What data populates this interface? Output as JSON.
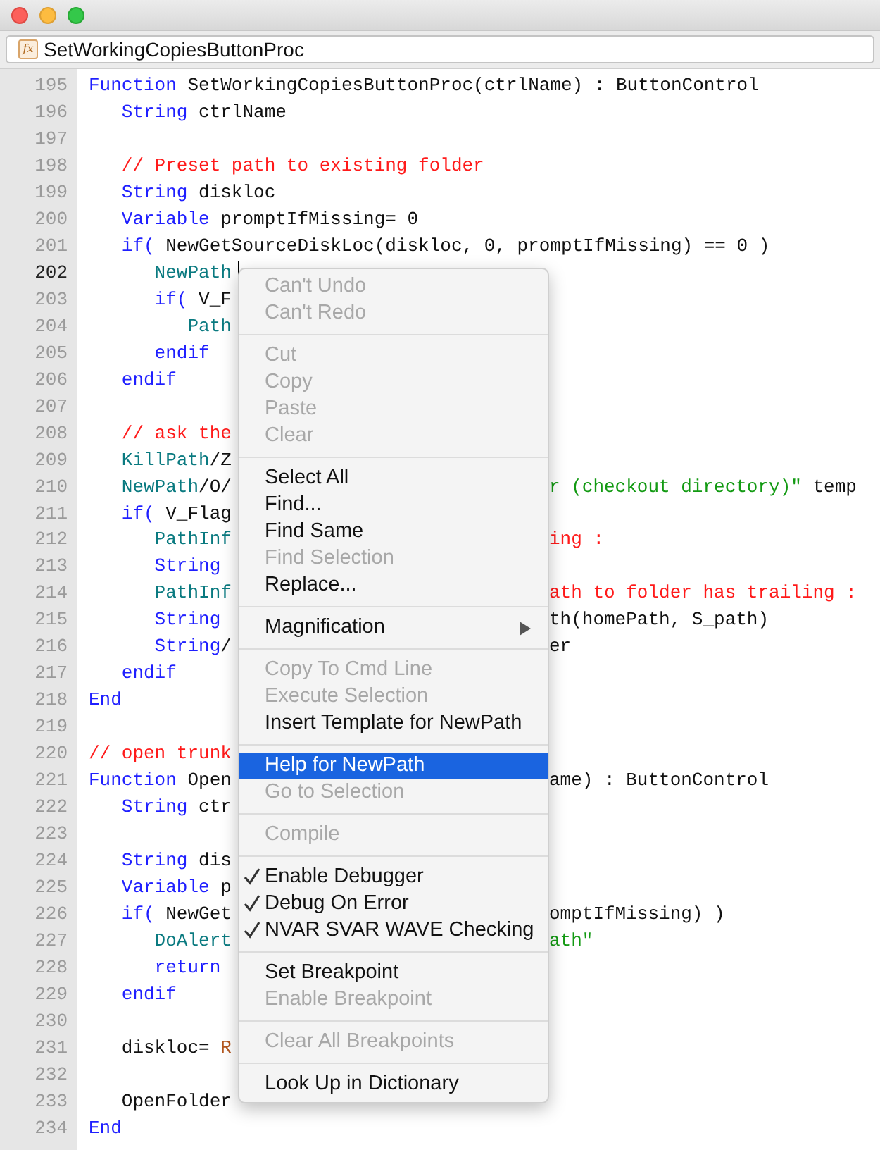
{
  "window": {
    "icon_text": "fx",
    "title": "SetWorkingCopiesButtonProc"
  },
  "code": [
    {
      "num": "195",
      "current": false,
      "left": [
        {
          "kind": "keyword",
          "text": "Function"
        },
        {
          "kind": "plain",
          "text": " SetWorkingCopiesButtonProc(ctrlName) : ButtonControl"
        }
      ]
    },
    {
      "num": "196",
      "current": false,
      "left": [
        {
          "kind": "keyword",
          "text": "   String"
        },
        {
          "kind": "plain",
          "text": " ctrlName"
        }
      ]
    },
    {
      "num": "197",
      "current": false
    },
    {
      "num": "198",
      "current": false,
      "left": [
        {
          "kind": "comment",
          "text": "   // Preset path to existing folder"
        }
      ]
    },
    {
      "num": "199",
      "current": false,
      "left": [
        {
          "kind": "keyword",
          "text": "   String"
        },
        {
          "kind": "plain",
          "text": " diskloc"
        }
      ]
    },
    {
      "num": "200",
      "current": false,
      "left": [
        {
          "kind": "keyword",
          "text": "   Variable"
        },
        {
          "kind": "plain",
          "text": " promptIfMissing= 0"
        }
      ]
    },
    {
      "num": "201",
      "current": false,
      "left": [
        {
          "kind": "keyword",
          "text": "   if("
        },
        {
          "kind": "plain",
          "text": " NewGetSourceDiskLoc(diskloc, 0, promptIfMissing) == 0 )"
        }
      ]
    },
    {
      "num": "202",
      "current": true,
      "left": [
        {
          "kind": "func",
          "text": "      NewPath"
        }
      ]
    },
    {
      "num": "203",
      "current": false,
      "left": [
        {
          "kind": "keyword",
          "text": "      if("
        },
        {
          "kind": "plain",
          "text": " V_F"
        }
      ]
    },
    {
      "num": "204",
      "current": false,
      "left": [
        {
          "kind": "func",
          "text": "         Path"
        }
      ]
    },
    {
      "num": "205",
      "current": false,
      "left": [
        {
          "kind": "keyword",
          "text": "      endif"
        }
      ]
    },
    {
      "num": "206",
      "current": false,
      "left": [
        {
          "kind": "keyword",
          "text": "   endif"
        }
      ]
    },
    {
      "num": "207",
      "current": false
    },
    {
      "num": "208",
      "current": false,
      "left": [
        {
          "kind": "comment",
          "text": "   // ask the"
        }
      ]
    },
    {
      "num": "209",
      "current": false,
      "left": [
        {
          "kind": "func",
          "text": "   KillPath"
        },
        {
          "kind": "plain",
          "text": "/Z"
        }
      ]
    },
    {
      "num": "210",
      "current": false,
      "left": [
        {
          "kind": "func",
          "text": "   NewPath"
        },
        {
          "kind": "plain",
          "text": "/O/"
        }
      ],
      "right": [
        {
          "kind": "string",
          "text": "r (checkout directory)\""
        },
        {
          "kind": "plain",
          "text": " temp"
        }
      ]
    },
    {
      "num": "211",
      "current": false,
      "left": [
        {
          "kind": "keyword",
          "text": "   if("
        },
        {
          "kind": "plain",
          "text": " V_Flag"
        }
      ]
    },
    {
      "num": "212",
      "current": false,
      "left": [
        {
          "kind": "func",
          "text": "      PathInf"
        }
      ],
      "right": [
        {
          "kind": "comment",
          "text": "ing :"
        }
      ]
    },
    {
      "num": "213",
      "current": false,
      "left": [
        {
          "kind": "keyword",
          "text": "      String"
        }
      ]
    },
    {
      "num": "214",
      "current": false,
      "left": [
        {
          "kind": "func",
          "text": "      PathInf"
        }
      ],
      "right": [
        {
          "kind": "comment",
          "text": "ath to folder has trailing :"
        }
      ]
    },
    {
      "num": "215",
      "current": false,
      "left": [
        {
          "kind": "keyword",
          "text": "      String"
        }
      ],
      "right": [
        {
          "kind": "plain",
          "text": "th(homePath, S_path)"
        }
      ]
    },
    {
      "num": "216",
      "current": false,
      "left": [
        {
          "kind": "keyword",
          "text": "      String"
        },
        {
          "kind": "plain",
          "text": "/"
        }
      ],
      "right": [
        {
          "kind": "plain",
          "text": "er"
        }
      ]
    },
    {
      "num": "217",
      "current": false,
      "left": [
        {
          "kind": "keyword",
          "text": "   endif"
        }
      ]
    },
    {
      "num": "218",
      "current": false,
      "left": [
        {
          "kind": "keyword",
          "text": "End"
        }
      ]
    },
    {
      "num": "219",
      "current": false
    },
    {
      "num": "220",
      "current": false,
      "left": [
        {
          "kind": "comment",
          "text": "// open trunk"
        }
      ]
    },
    {
      "num": "221",
      "current": false,
      "left": [
        {
          "kind": "keyword",
          "text": "Function"
        },
        {
          "kind": "plain",
          "text": " Open"
        }
      ],
      "right": [
        {
          "kind": "plain",
          "text": "ame) : ButtonControl"
        }
      ]
    },
    {
      "num": "222",
      "current": false,
      "left": [
        {
          "kind": "keyword",
          "text": "   String"
        },
        {
          "kind": "plain",
          "text": " ctr"
        }
      ]
    },
    {
      "num": "223",
      "current": false
    },
    {
      "num": "224",
      "current": false,
      "left": [
        {
          "kind": "keyword",
          "text": "   String"
        },
        {
          "kind": "plain",
          "text": " dis"
        }
      ]
    },
    {
      "num": "225",
      "current": false,
      "left": [
        {
          "kind": "keyword",
          "text": "   Variable"
        },
        {
          "kind": "plain",
          "text": " p"
        }
      ]
    },
    {
      "num": "226",
      "current": false,
      "left": [
        {
          "kind": "keyword",
          "text": "   if("
        },
        {
          "kind": "plain",
          "text": " NewGet"
        }
      ],
      "right": [
        {
          "kind": "plain",
          "text": "omptIfMissing) )"
        }
      ]
    },
    {
      "num": "227",
      "current": false,
      "left": [
        {
          "kind": "func",
          "text": "      DoAlert"
        }
      ],
      "right": [
        {
          "kind": "string",
          "text": "ath\""
        }
      ]
    },
    {
      "num": "228",
      "current": false,
      "left": [
        {
          "kind": "keyword",
          "text": "      return"
        }
      ]
    },
    {
      "num": "229",
      "current": false,
      "left": [
        {
          "kind": "keyword",
          "text": "   endif"
        }
      ]
    },
    {
      "num": "230",
      "current": false
    },
    {
      "num": "231",
      "current": false,
      "left": [
        {
          "kind": "plain",
          "text": "   diskloc= "
        },
        {
          "kind": "builtin",
          "text": "R"
        }
      ]
    },
    {
      "num": "232",
      "current": false
    },
    {
      "num": "233",
      "current": false,
      "left": [
        {
          "kind": "plain",
          "text": "   OpenFolder"
        }
      ]
    },
    {
      "num": "234",
      "current": false,
      "left": [
        {
          "kind": "keyword",
          "text": "End"
        }
      ]
    }
  ],
  "context_menu": [
    {
      "kind": "item",
      "label": "Can't Undo",
      "disabled": true,
      "checked": false,
      "selected": false
    },
    {
      "kind": "item",
      "label": "Can't Redo",
      "disabled": true,
      "checked": false,
      "selected": false
    },
    {
      "kind": "separator"
    },
    {
      "kind": "item",
      "label": "Cut",
      "disabled": true,
      "checked": false,
      "selected": false
    },
    {
      "kind": "item",
      "label": "Copy",
      "disabled": true,
      "checked": false,
      "selected": false
    },
    {
      "kind": "item",
      "label": "Paste",
      "disabled": true,
      "checked": false,
      "selected": false
    },
    {
      "kind": "item",
      "label": "Clear",
      "disabled": true,
      "checked": false,
      "selected": false
    },
    {
      "kind": "separator"
    },
    {
      "kind": "item",
      "label": "Select All",
      "disabled": false,
      "checked": false,
      "selected": false
    },
    {
      "kind": "item",
      "label": "Find...",
      "disabled": false,
      "checked": false,
      "selected": false
    },
    {
      "kind": "item",
      "label": "Find Same",
      "disabled": false,
      "checked": false,
      "selected": false
    },
    {
      "kind": "item",
      "label": "Find Selection",
      "disabled": true,
      "checked": false,
      "selected": false
    },
    {
      "kind": "item",
      "label": "Replace...",
      "disabled": false,
      "checked": false,
      "selected": false
    },
    {
      "kind": "separator"
    },
    {
      "kind": "submenu",
      "label": "Magnification",
      "disabled": false,
      "checked": false,
      "selected": false
    },
    {
      "kind": "separator"
    },
    {
      "kind": "item",
      "label": "Copy To Cmd Line",
      "disabled": true,
      "checked": false,
      "selected": false
    },
    {
      "kind": "item",
      "label": "Execute Selection",
      "disabled": true,
      "checked": false,
      "selected": false
    },
    {
      "kind": "item",
      "label": "Insert Template for NewPath",
      "disabled": false,
      "checked": false,
      "selected": false
    },
    {
      "kind": "separator"
    },
    {
      "kind": "item",
      "label": "Help for NewPath",
      "disabled": false,
      "checked": false,
      "selected": true
    },
    {
      "kind": "item",
      "label": "Go to Selection",
      "disabled": true,
      "checked": false,
      "selected": false
    },
    {
      "kind": "separator"
    },
    {
      "kind": "item",
      "label": "Compile",
      "disabled": true,
      "checked": false,
      "selected": false
    },
    {
      "kind": "separator"
    },
    {
      "kind": "item",
      "label": "Enable Debugger",
      "disabled": false,
      "checked": true,
      "selected": false
    },
    {
      "kind": "item",
      "label": "Debug On Error",
      "disabled": false,
      "checked": true,
      "selected": false
    },
    {
      "kind": "item",
      "label": "NVAR SVAR WAVE Checking",
      "disabled": false,
      "checked": true,
      "selected": false
    },
    {
      "kind": "separator"
    },
    {
      "kind": "item",
      "label": "Set Breakpoint",
      "disabled": false,
      "checked": false,
      "selected": false
    },
    {
      "kind": "item",
      "label": "Enable Breakpoint",
      "disabled": true,
      "checked": false,
      "selected": false
    },
    {
      "kind": "separator"
    },
    {
      "kind": "item",
      "label": "Clear All Breakpoints",
      "disabled": true,
      "checked": false,
      "selected": false
    },
    {
      "kind": "separator"
    },
    {
      "kind": "item",
      "label": "Look Up in Dictionary",
      "disabled": false,
      "checked": false,
      "selected": false
    }
  ]
}
